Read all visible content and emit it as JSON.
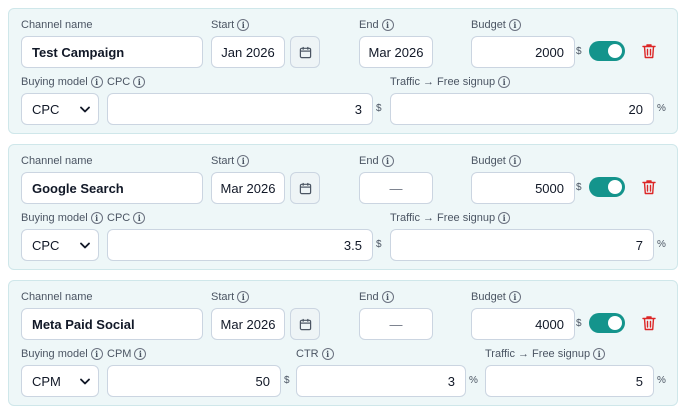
{
  "labels": {
    "channel_name": "Channel name",
    "start": "Start",
    "end": "End",
    "budget": "Budget",
    "buying_model": "Buying model",
    "cpc": "CPC",
    "cpm": "CPM",
    "ctr": "CTR",
    "traffic_signup": "Traffic → Free signup"
  },
  "units": {
    "currency": "$",
    "percent": "%"
  },
  "icons": {
    "info": "info-circle-icon",
    "calendar": "calendar-icon",
    "delete": "trash-icon",
    "dropdown": "chevron-down-icon"
  },
  "colors": {
    "toggle_on": "#14948c",
    "delete": "#dc2626",
    "card_bg": "#eef7f8"
  },
  "channels": [
    {
      "name": "Test Campaign",
      "start": "Jan 2026",
      "end": "Mar 2026",
      "budget": "2000",
      "enabled": true,
      "buying_model": "CPC",
      "cost": "3",
      "traffic_signup": "20"
    },
    {
      "name": "Google Search",
      "start": "Mar 2026",
      "end": "—",
      "budget": "5000",
      "enabled": true,
      "buying_model": "CPC",
      "cost": "3.5",
      "traffic_signup": "7"
    },
    {
      "name": "Meta Paid Social",
      "start": "Mar 2026",
      "end": "—",
      "budget": "4000",
      "enabled": true,
      "buying_model": "CPM",
      "cost": "50",
      "ctr": "3",
      "traffic_signup": "5"
    }
  ]
}
